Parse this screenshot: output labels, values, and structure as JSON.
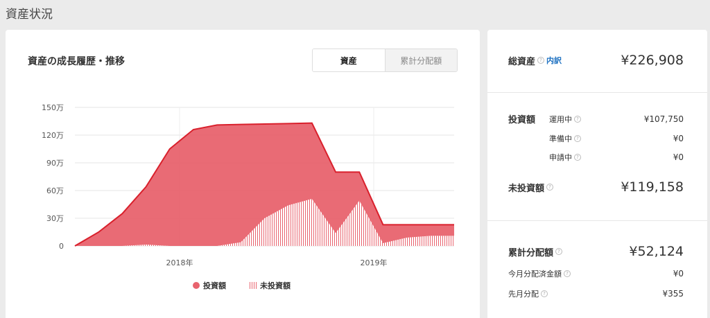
{
  "page": {
    "title": "資産状況"
  },
  "chart_panel": {
    "title": "資産の成長履歴・推移",
    "tabs": [
      {
        "label": "資産",
        "active": true
      },
      {
        "label": "累計分配額",
        "active": false
      }
    ]
  },
  "chart_data": {
    "type": "area",
    "unit": "万",
    "ylim": [
      0,
      150
    ],
    "y_ticks": [
      0,
      30,
      60,
      90,
      120,
      150
    ],
    "y_tick_labels": [
      "0",
      "30万",
      "60万",
      "90万",
      "120万",
      "150万"
    ],
    "x_tick_labels": [
      "2018年",
      "2019年"
    ],
    "grid": true,
    "legend_position": "bottom",
    "series": [
      {
        "name": "投資額",
        "style": "filled",
        "color": "#e8636e",
        "values": [
          0,
          15,
          35,
          64,
          105,
          126,
          131,
          131.5,
          132,
          132.5,
          133,
          80,
          80,
          23,
          23,
          23,
          23
        ]
      },
      {
        "name": "未投資額",
        "style": "hatched",
        "color": "#e8636e",
        "values": [
          0,
          0,
          0,
          1.5,
          0,
          0,
          0,
          4,
          30,
          44,
          51,
          14,
          49,
          3,
          9,
          11,
          11
        ]
      }
    ]
  },
  "summary": {
    "total": {
      "label": "総資産",
      "link": "内訳",
      "value": "¥226,908"
    },
    "invested": {
      "label": "投資額",
      "rows": [
        {
          "label": "運用中",
          "value": "¥107,750"
        },
        {
          "label": "準備中",
          "value": "¥0"
        },
        {
          "label": "申請中",
          "value": "¥0"
        }
      ]
    },
    "uninvested": {
      "label": "未投資額",
      "value": "¥119,158"
    },
    "dividends": {
      "label": "累計分配額",
      "value": "¥52,124",
      "rows": [
        {
          "label": "今月分配済金額",
          "value": "¥0"
        },
        {
          "label": "先月分配",
          "value": "¥355"
        }
      ]
    }
  }
}
